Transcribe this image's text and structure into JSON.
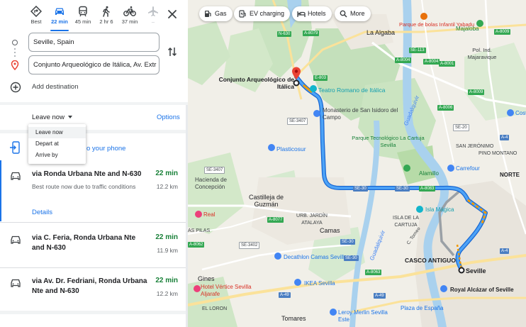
{
  "travel_modes": [
    {
      "name": "best",
      "label": "Best",
      "active": false
    },
    {
      "name": "driving",
      "label": "22 min",
      "active": true
    },
    {
      "name": "transit",
      "label": "45 min",
      "active": false
    },
    {
      "name": "walking",
      "label": "2 hr 6",
      "active": false
    },
    {
      "name": "cycling",
      "label": "37 min",
      "active": false
    },
    {
      "name": "flights",
      "label": "–",
      "active": false
    }
  ],
  "route_inputs": {
    "origin": "Seville, Spain",
    "destination": "Conjunto Arqueológico de Itálica, Av. Extr",
    "add_destination": "Add destination"
  },
  "departure": {
    "leave_label": "Leave now",
    "options_label": "Options",
    "dropdown": [
      "Leave now",
      "Depart at",
      "Arrive by"
    ]
  },
  "send_to_phone": "o your phone",
  "routes": [
    {
      "name": "via Ronda Urbana Nte and N-630",
      "time": "22 min",
      "distance": "12.2 km",
      "note": "Best route now due to traffic conditions",
      "details": "Details"
    },
    {
      "name": "via C. Feria, Ronda Urbana Nte and N-630",
      "time": "22 min",
      "distance": "11.9 km"
    },
    {
      "name": "via Av. Dr. Fedriani, Ronda Urbana Nte and N-630",
      "time": "22 min",
      "distance": "12.2 km"
    }
  ],
  "map": {
    "chips": [
      {
        "name": "gas",
        "label": "Gas"
      },
      {
        "name": "ev-charging",
        "label": "EV charging"
      },
      {
        "name": "hotels",
        "label": "Hotels"
      },
      {
        "name": "more",
        "label": "More"
      }
    ],
    "places": {
      "algaba": "La Algaba",
      "bolas": "Parque de bolas Infantil Yabadu",
      "majaloba": "Majaloba",
      "poligono": "Pol. Ind. Majaravique",
      "conjunto": "Conjunto Arqueológico de Itálica",
      "teatro": "Teatro Romano de Itálica",
      "monasterio": "Monasterio de San Isidoro del Campo",
      "guadalquivir1": "Guadalquivir",
      "guadalquivir2": "Guadalquivir",
      "plasticosur": "Plasticosur",
      "cartuja": "Parque Tecnológico La Cartuja Sevilla",
      "alamillo": "Alamillo",
      "jeronimo": "SAN JERÓNIMO",
      "pino": "PINO MONTANO",
      "carrefour": "Carrefour",
      "norte": "NORTE",
      "costco": "Costco",
      "concepcion": "Hacienda de Concepción",
      "castilleja": "Castilleja de Guzmán",
      "real": "Real",
      "jardin": "URB. JARDÍN ATALAYA",
      "camas": "Camas",
      "isla": "ISLA DE LA CARTUJA",
      "islamagica": "Isla Mágica",
      "pilas": "AS PILAS",
      "decathlon": "Decathlon Camas Sevilla",
      "casco": "CASCO ANTIGUO",
      "seville": "Seville",
      "gines": "Gines",
      "vertice": "Hotel Vértice Sevilla Aljarafe",
      "ikea": "IKEA Sevilla",
      "alcazar": "Royal Alcázar of Seville",
      "espana": "Plaza de España",
      "loron": "EL LORON",
      "tomares": "Tomares",
      "leroy": "Leroy Merlin Sevilla Este",
      "torneo": "C. Torneo"
    },
    "roads": [
      "N-630",
      "A-8079",
      "E-803",
      "SE-3407",
      "SE-3407",
      "SE-30",
      "SE-30",
      "A-8083",
      "A-8077",
      "SE-3402",
      "A-8062",
      "SE-30",
      "A-49",
      "A-8063",
      "A-4",
      "A-8009",
      "A-8004",
      "SE-20",
      "SE-113",
      "A-8006",
      "A-8004",
      "A-4",
      "A-8001",
      "A-8009",
      "A-49",
      "SE-30"
    ]
  }
}
